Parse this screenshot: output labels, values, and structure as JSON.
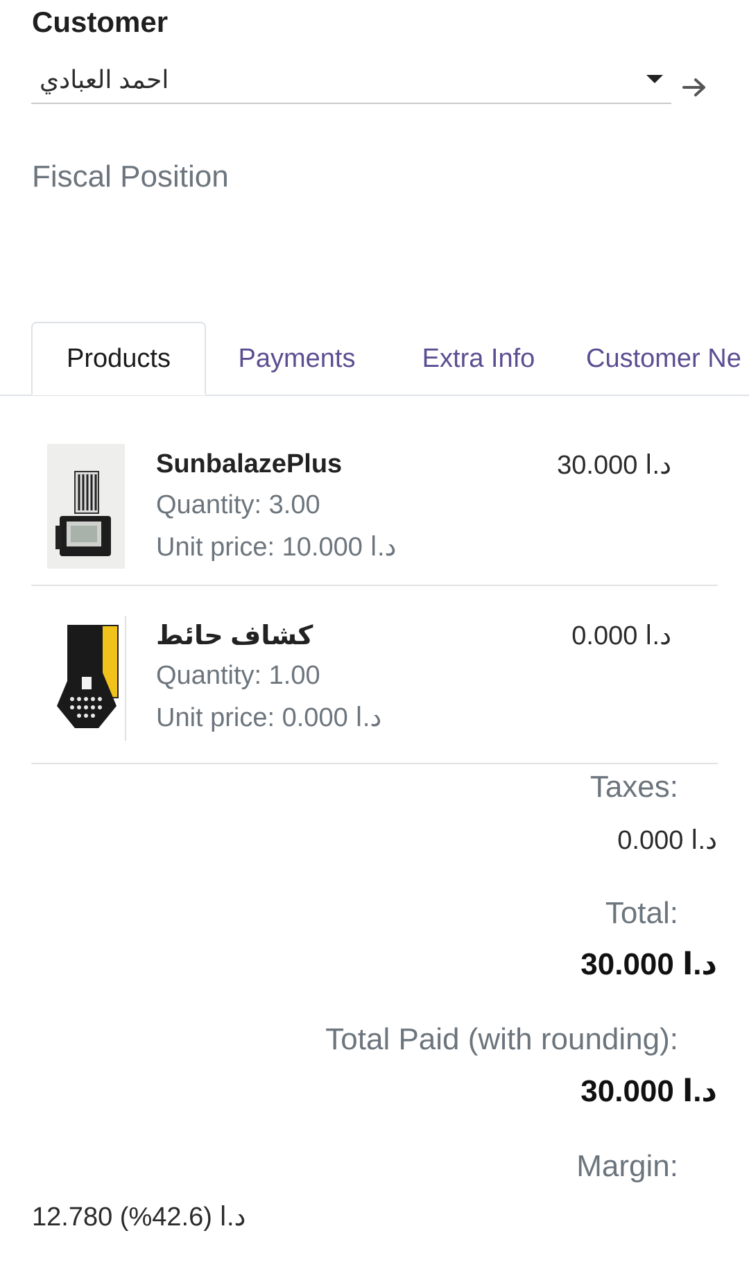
{
  "customer": {
    "label": "Customer",
    "value": "احمد العبادي"
  },
  "fiscal_position": {
    "label": "Fiscal Position"
  },
  "tabs": [
    {
      "label": "Products",
      "active": true
    },
    {
      "label": "Payments",
      "active": false
    },
    {
      "label": "Extra Info",
      "active": false
    },
    {
      "label": "Customer Ne",
      "active": false
    }
  ],
  "lines": [
    {
      "name": "SunbalazePlus",
      "quantity": "Quantity: 3.00",
      "unit_price": "Unit price: 10.000 د.ا",
      "subtotal": "30.000 د.ا",
      "image": "solar-floodlight-image"
    },
    {
      "name": "كشاف حائط",
      "quantity": "Quantity: 1.00",
      "unit_price": "Unit price: 0.000 د.ا",
      "subtotal": "0.000 د.ا",
      "image": "wall-lamp-image"
    }
  ],
  "totals": {
    "taxes_label": "Taxes:",
    "taxes_value": "0.000 د.ا",
    "total_label": "Total:",
    "total_value": "30.000 د.ا",
    "paid_label": "Total Paid (with rounding):",
    "paid_value": "30.000 د.ا",
    "margin_label": "Margin:",
    "margin_value": "12.780 د.ا (42.6%)"
  },
  "colors": {
    "tab_link": "#5c4e92",
    "muted_text": "#6c757d",
    "border": "#dee2e6"
  }
}
